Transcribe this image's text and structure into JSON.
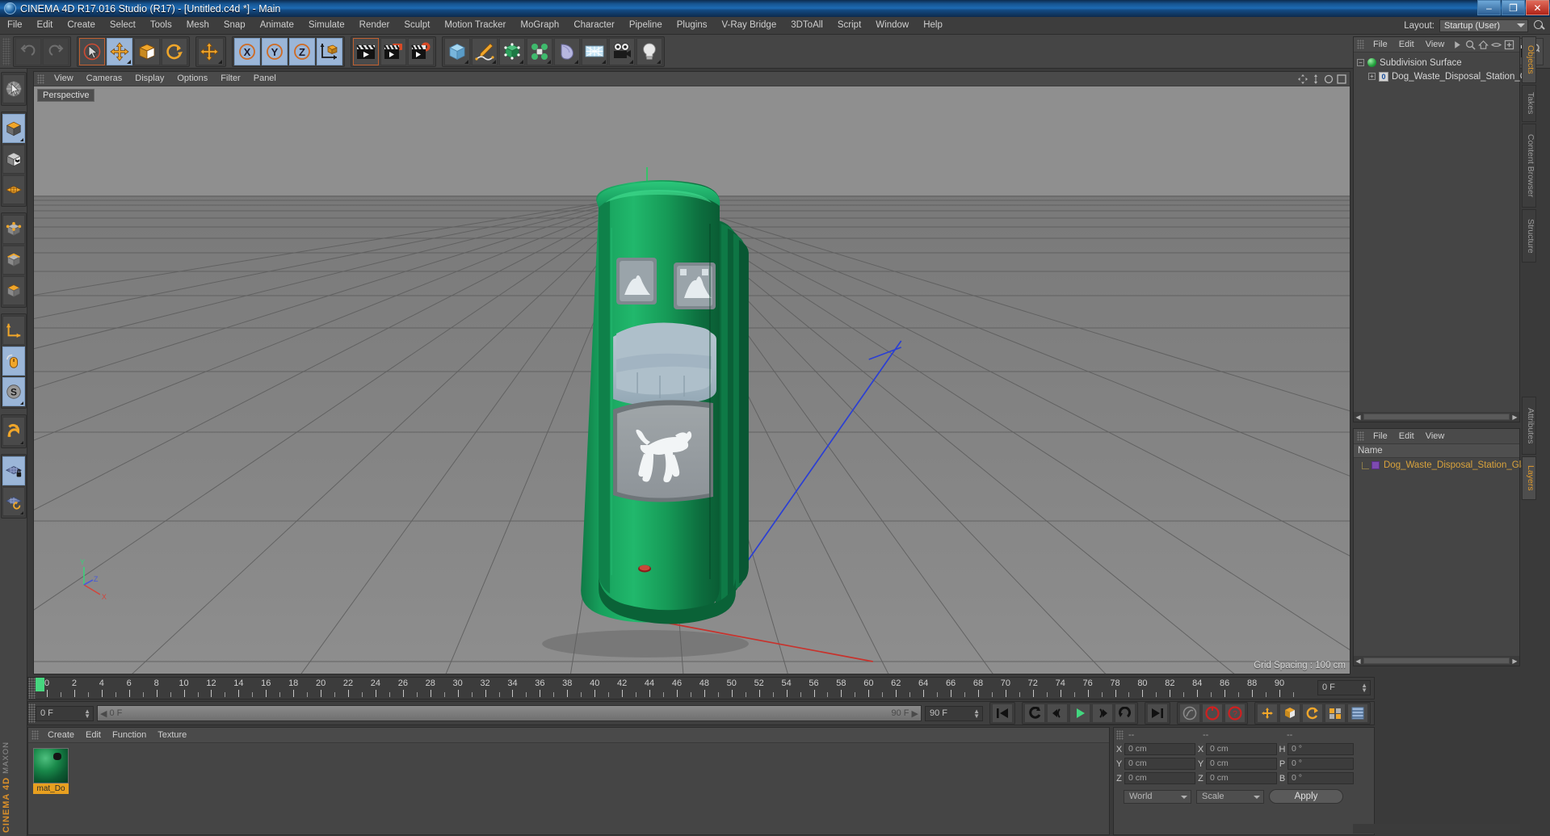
{
  "window": {
    "title": "CINEMA 4D R17.016 Studio (R17) - [Untitled.c4d *] - Main",
    "minimize": "–",
    "maximize": "❐",
    "close": "✕"
  },
  "menubar": {
    "items": [
      "File",
      "Edit",
      "Create",
      "Select",
      "Tools",
      "Mesh",
      "Snap",
      "Animate",
      "Simulate",
      "Render",
      "Sculpt",
      "Motion Tracker",
      "MoGraph",
      "Character",
      "Pipeline",
      "Plugins",
      "V-Ray Bridge",
      "3DToAll",
      "Script",
      "Window",
      "Help"
    ],
    "layout_label": "Layout:",
    "layout_value": "Startup (User)"
  },
  "toolbar": {
    "icons": [
      "undo-icon",
      "redo-icon",
      "select-tool-icon",
      "move-tool-icon",
      "scale-tool-icon",
      "rotate-tool-icon",
      "move-axis-icon",
      "axis-x-icon",
      "axis-y-icon",
      "axis-z-icon",
      "world-coordinate-icon",
      "render-view-icon",
      "render-to-picture-viewer-icon",
      "render-settings-icon",
      "cube-primitive-icon",
      "spline-pen-icon",
      "nurbs-generator-icon",
      "mograph-array-icon",
      "deformer-bend-icon",
      "floor-environment-icon",
      "camera-icon",
      "light-icon"
    ]
  },
  "lefttoolbar": {
    "icons": [
      "live-selection-icon",
      "model-mode-icon",
      "texture-mode-icon",
      "polygon-mode-icon",
      "points-mode-icon",
      "edges-mode-icon",
      "object-mode-icon",
      "axis-modify-icon",
      "viewport-solo-icon",
      "enable-snap-icon",
      "magnet-icon",
      "workplane-lock-icon",
      "workplane-rotate-icon"
    ],
    "brand": "CINEMA 4D",
    "brand_vendor": "MAXON"
  },
  "viewport": {
    "menu": [
      "View",
      "Cameras",
      "Display",
      "Options",
      "Filter",
      "Panel"
    ],
    "label": "Perspective",
    "grid_spacing": "Grid Spacing : 100 cm",
    "axis_labels": {
      "x": "X",
      "y": "Y",
      "z": "Z"
    }
  },
  "object_manager": {
    "menu": [
      "File",
      "Edit",
      "View"
    ],
    "icons": [
      "search-icon",
      "home-icon",
      "eye-icon",
      "fit-icon",
      "play-arrow-icon"
    ],
    "items": [
      {
        "label": "Subdivision Surface",
        "depth": 0,
        "icon": "subdivision-surface-icon"
      },
      {
        "label": "Dog_Waste_Disposal_Station_Gl",
        "depth": 1,
        "icon": "polygon-object-icon",
        "badge": "0"
      }
    ]
  },
  "layer_manager": {
    "menu": [
      "File",
      "Edit",
      "View"
    ],
    "column_header": "Name",
    "rows": [
      {
        "label": "Dog_Waste_Disposal_Station_Gla",
        "color": "#7d4bb0"
      }
    ]
  },
  "right_tabs": {
    "top": [
      "Objects",
      "Takes",
      "Content Browser",
      "Structure"
    ],
    "top_active": "Objects",
    "bottom": [
      "Attributes",
      "Layers"
    ],
    "bottom_active": "Layers"
  },
  "timeline": {
    "ticks": [
      0,
      2,
      4,
      6,
      8,
      10,
      12,
      14,
      16,
      18,
      20,
      22,
      24,
      26,
      28,
      30,
      32,
      34,
      36,
      38,
      40,
      42,
      44,
      46,
      48,
      50,
      52,
      54,
      56,
      58,
      60,
      62,
      64,
      66,
      68,
      70,
      72,
      74,
      76,
      78,
      80,
      82,
      84,
      86,
      88,
      90
    ],
    "current_frame_field": "0 F",
    "start": 0,
    "end": 90
  },
  "transport": {
    "start_field": "0 F",
    "slider_value": "0 F",
    "slider_end": "90 F",
    "end_field": "90 F",
    "buttons": [
      "go-to-start-icon",
      "play-reverse-icon",
      "step-back-icon",
      "play-forward-icon",
      "step-forward-icon",
      "loop-icon",
      "go-to-end-icon",
      "autokey-icon",
      "record-icon",
      "record-question-icon",
      "key-position-icon",
      "key-scale-icon",
      "key-rotation-icon",
      "key-param-icon",
      "key-pla-icon",
      "key-selection-icon"
    ]
  },
  "material_manager": {
    "menu": [
      "Create",
      "Edit",
      "Function",
      "Texture"
    ],
    "materials": [
      {
        "name": "mat_Do",
        "color": "#19894a"
      }
    ]
  },
  "coordinates": {
    "header_dashes": [
      "--",
      "--",
      "--"
    ],
    "rows": [
      {
        "l1": "X",
        "v1": "0 cm",
        "l2": "X",
        "v2": "0 cm",
        "l3": "H",
        "v3": "0 °"
      },
      {
        "l1": "Y",
        "v1": "0 cm",
        "l2": "Y",
        "v2": "0 cm",
        "l3": "P",
        "v3": "0 °"
      },
      {
        "l1": "Z",
        "v1": "0 cm",
        "l2": "Z",
        "v2": "0 cm",
        "l3": "B",
        "v3": "0 °"
      }
    ],
    "system": "World",
    "mode": "Scale",
    "apply": "Apply"
  }
}
